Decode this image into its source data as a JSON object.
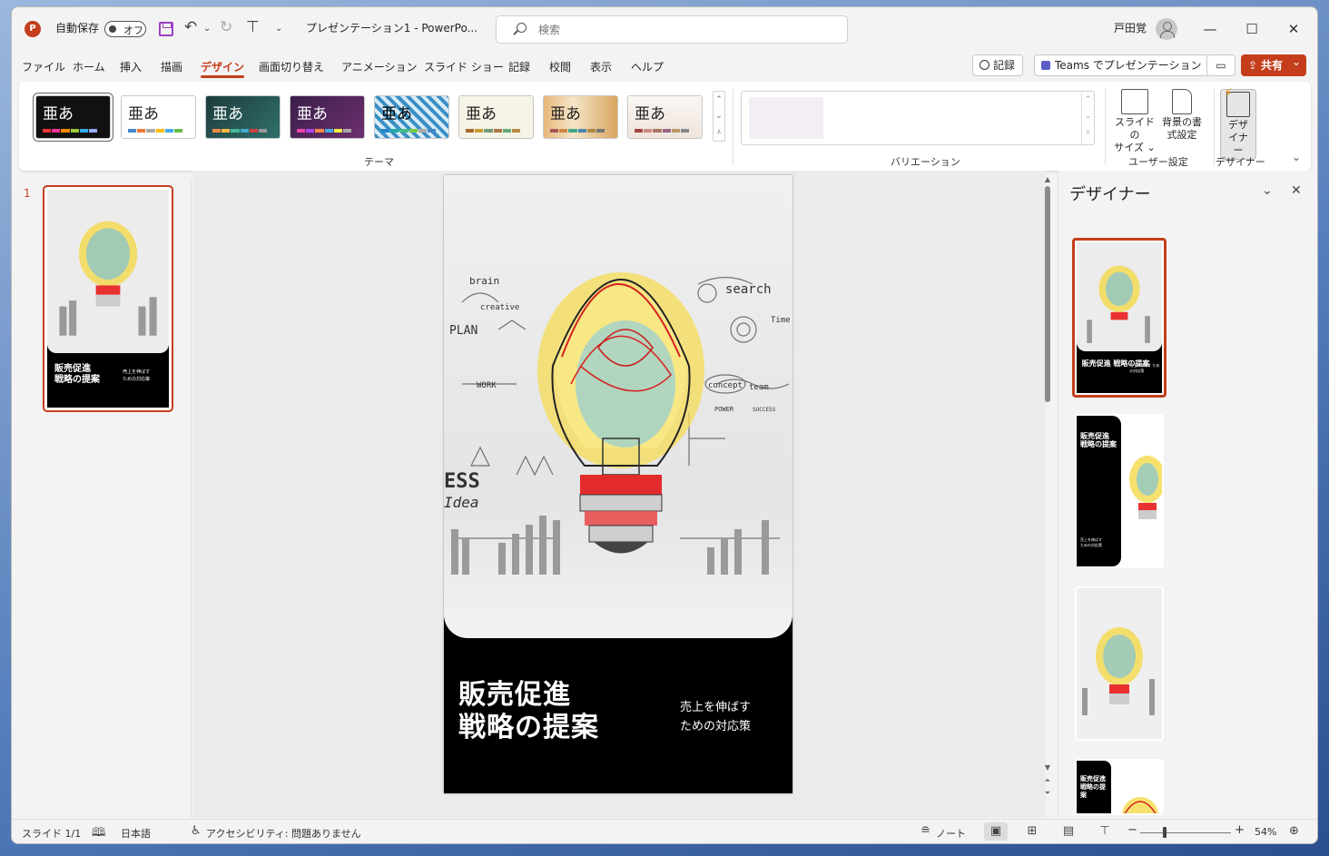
{
  "titlebar": {
    "app_icon_letter": "P",
    "autosave_label": "自動保存",
    "autosave_state": "オフ",
    "document_title": "プレゼンテーション1 - PowerPo...",
    "search_placeholder": "検索",
    "user_name": "戸田覚",
    "minimize": "—",
    "maximize": "☐",
    "close": "✕"
  },
  "menu": {
    "tabs": [
      "ファイル",
      "ホーム",
      "挿入",
      "描画",
      "デザイン",
      "画面切り替え",
      "アニメーション",
      "スライド ショー",
      "記録",
      "校閲",
      "表示",
      "ヘルプ"
    ],
    "active_tab": "デザイン",
    "record_button": "記録",
    "teams_button": "Teams でプレゼンテーション",
    "share_button": "共有"
  },
  "ribbon": {
    "theme_glyph": "亜あ",
    "group_themes": "テーマ",
    "group_variations": "バリエーション",
    "group_customize": "ユーザー設定",
    "group_designer": "デザイナー",
    "slide_size_label": "スライドの\nサイズ ⌄",
    "background_label": "背景の書\n式設定",
    "designer_label": "デザ\nイナー"
  },
  "thumbnails": {
    "slide_number": "1"
  },
  "slide": {
    "title": "販売促進\n戦略の提案",
    "subtitle": "売上を伸ばす\nための対応策",
    "sketch_words": [
      "brain",
      "creative",
      "search",
      "PLAN",
      "WORK",
      "concept",
      "team",
      "POWER",
      "SUCCESS",
      "ESS",
      "Idea",
      "Time"
    ]
  },
  "designer_pane": {
    "title": "デザイナー",
    "collapse_icon": "⌄",
    "close_icon": "✕"
  },
  "statusbar": {
    "slide_position": "スライド 1/1",
    "language": "日本語",
    "accessibility": "アクセシビリティ: 問題ありません",
    "notes": "ノート",
    "zoom_level": "54%",
    "zoom_minus": "−",
    "zoom_plus": "+"
  },
  "colors": {
    "accent": "#c43e1c",
    "slide_background": "#000000",
    "save_icon": "#9b3fbf"
  }
}
